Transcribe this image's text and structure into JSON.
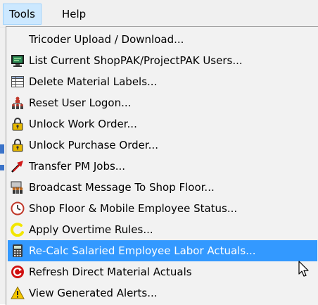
{
  "menubar": {
    "tools_label": "Tools",
    "help_label": "Help"
  },
  "menu": {
    "items": [
      {
        "label": "Tricoder Upload / Download...",
        "icon": "none"
      },
      {
        "label": "List Current ShopPAK/ProjectPAK Users...",
        "icon": "monitor-icon"
      },
      {
        "label": "Delete Material Labels...",
        "icon": "table-grid-icon"
      },
      {
        "label": "Reset User Logon...",
        "icon": "users-hierarchy-icon"
      },
      {
        "label": "Unlock Work Order...",
        "icon": "padlock-icon"
      },
      {
        "label": "Unlock Purchase Order...",
        "icon": "padlock-icon"
      },
      {
        "label": "Transfer PM Jobs...",
        "icon": "red-arrow-icon"
      },
      {
        "label": "Broadcast Message To Shop Floor...",
        "icon": "broadcast-people-icon"
      },
      {
        "label": "Shop Floor & Mobile Employee Status...",
        "icon": "clock-icon"
      },
      {
        "label": "Apply Overtime Rules...",
        "icon": "yellow-spinner-icon"
      },
      {
        "label": "Re-Calc Salaried Employee Labor Actuals...",
        "icon": "calculator-icon",
        "highlighted": true
      },
      {
        "label": "Refresh Direct Material Actuals",
        "icon": "red-refresh-icon"
      },
      {
        "label": "View Generated Alerts...",
        "icon": "warning-triangle-icon"
      }
    ]
  },
  "colors": {
    "highlight": "#3399ff",
    "menubar_active": "#cce8ff",
    "menu_background": "#f2f2f2"
  }
}
